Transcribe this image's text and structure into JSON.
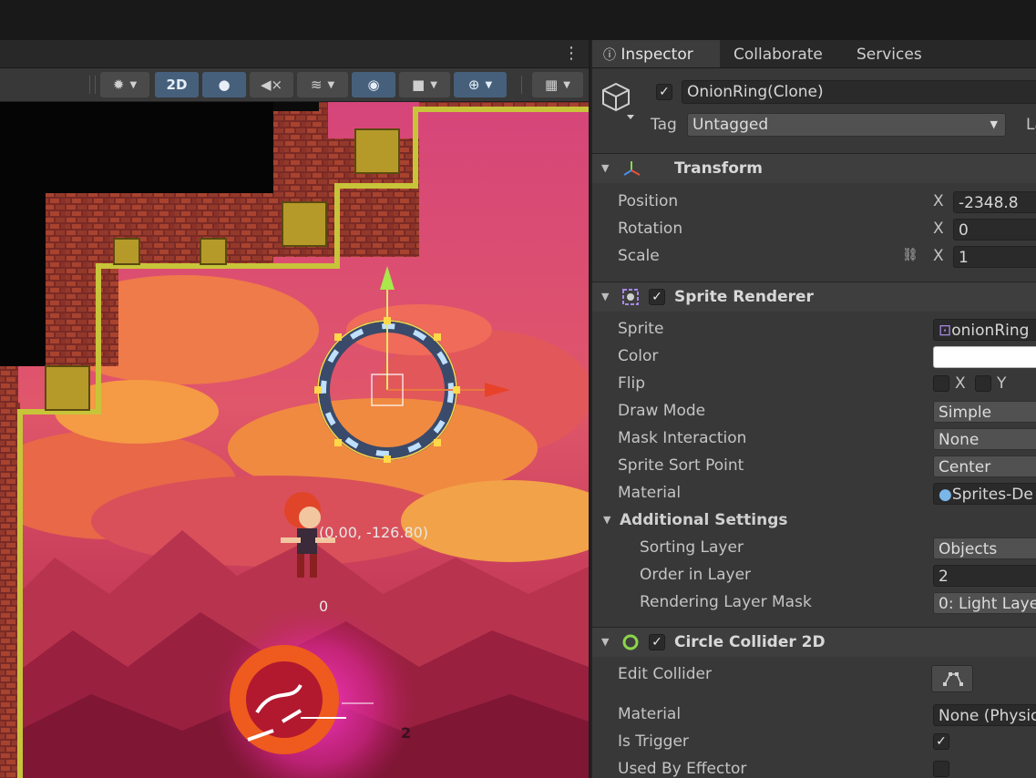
{
  "scene_toolbar": {
    "buttons": [
      {
        "name": "gizmo-debug-button",
        "label": ""
      },
      {
        "name": "2d-toggle-button",
        "label": "2D"
      },
      {
        "name": "lighting-toggle-button",
        "label": ""
      },
      {
        "name": "audio-toggle-button",
        "label": ""
      },
      {
        "name": "effects-button",
        "label": ""
      },
      {
        "name": "visibility-toggle-button",
        "label": ""
      },
      {
        "name": "camera-button",
        "label": ""
      },
      {
        "name": "gizmos-button",
        "label": ""
      },
      {
        "name": "grid-button",
        "label": ""
      }
    ]
  },
  "scene": {
    "position_readout": "(0.00, -126.80)",
    "zero_readout": "0",
    "damage_number": "2"
  },
  "inspector": {
    "tabs": [
      "Inspector",
      "Collaborate",
      "Services"
    ],
    "object": {
      "name": "OnionRing(Clone)",
      "active": true,
      "tag_label": "Tag",
      "tag_value": "Untagged",
      "layer_label_partial": "La"
    },
    "transform": {
      "title": "Transform",
      "position": {
        "label": "Position",
        "axis": "X",
        "value": "-2348.8"
      },
      "rotation": {
        "label": "Rotation",
        "axis": "X",
        "value": "0"
      },
      "scale": {
        "label": "Scale",
        "axis": "X",
        "value": "1"
      }
    },
    "sprite_renderer": {
      "title": "Sprite Renderer",
      "enabled": true,
      "sprite": {
        "label": "Sprite",
        "value": "onionRing"
      },
      "color": {
        "label": "Color",
        "value": "#ffffff"
      },
      "flip": {
        "label": "Flip",
        "x_label": "X",
        "y_label": "Y"
      },
      "draw_mode": {
        "label": "Draw Mode",
        "value": "Simple"
      },
      "mask_interaction": {
        "label": "Mask Interaction",
        "value": "None"
      },
      "sort_point": {
        "label": "Sprite Sort Point",
        "value": "Center"
      },
      "material": {
        "label": "Material",
        "value": "Sprites-De"
      },
      "additional": {
        "title": "Additional Settings",
        "sorting_layer": {
          "label": "Sorting Layer",
          "value": "Objects"
        },
        "order_in_layer": {
          "label": "Order in Layer",
          "value": "2"
        },
        "rendering_mask": {
          "label": "Rendering Layer Mask",
          "value": "0: Light Laye"
        }
      }
    },
    "circle_collider": {
      "title": "Circle Collider 2D",
      "enabled": true,
      "edit_collider": {
        "label": "Edit Collider"
      },
      "material": {
        "label": "Material",
        "value": "None (Physic"
      },
      "is_trigger": {
        "label": "Is Trigger",
        "checked": true
      },
      "used_by_effector": {
        "label": "Used By Effector",
        "checked": false
      }
    }
  },
  "colors": {
    "accent": "#46607c",
    "panel": "#383838",
    "sky": "#d94a7a",
    "wall_outline": "#c8c43a"
  }
}
